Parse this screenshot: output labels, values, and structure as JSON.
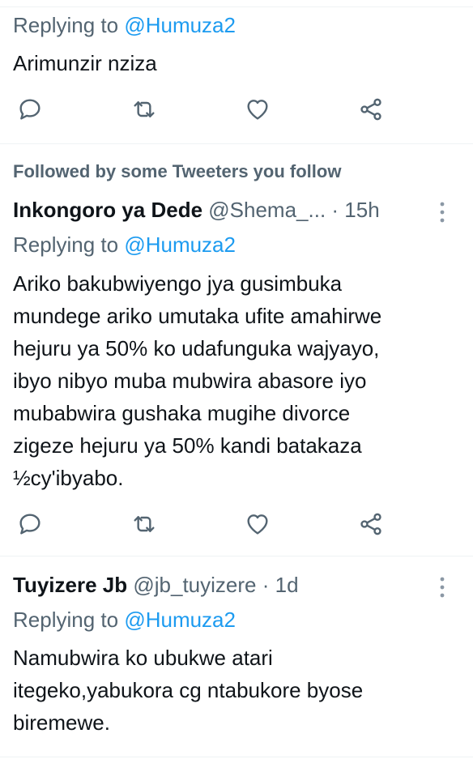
{
  "colors": {
    "accent": "#1d9bf0",
    "secondary": "#536471",
    "text": "#0f1419",
    "divider": "#eff3f4"
  },
  "tweets": [
    {
      "replying_prefix": "Replying to",
      "replying_handle": "@Humuza2",
      "text": "Arimunzir nziza",
      "icons": [
        "reply-icon",
        "retweet-icon",
        "like-icon",
        "share-icon"
      ]
    },
    {
      "social_context": "Followed by some Tweeters you follow",
      "name": "Inkongoro ya Dede",
      "handle": "@Shema_...",
      "time": "· 15h",
      "replying_prefix": "Replying to",
      "replying_handle": "@Humuza2",
      "text_lines": [
        "Ariko bakubwiyengo jya gusimbuka",
        "mundege ariko umutaka ufite amahirwe",
        "hejuru ya 50% ko udafunguka wajyayo,",
        "ibyo nibyo muba mubwira abasore iyo",
        "mubabwira gushaka mugihe divorce",
        "zigeze hejuru ya 50% kandi batakaza",
        "½cy'ibyabo."
      ],
      "icons": [
        "reply-icon",
        "retweet-icon",
        "like-icon",
        "share-icon",
        "more-icon"
      ]
    },
    {
      "name": "Tuyizere Jb",
      "handle": "@jb_tuyizere",
      "time": "· 1d",
      "replying_prefix": "Replying to",
      "replying_handle": "@Humuza2",
      "text_lines": [
        "Namubwira ko ubukwe atari",
        "itegeko,yabukora cg ntabukore byose",
        "biremewe."
      ],
      "icons": [
        "more-icon"
      ]
    }
  ]
}
